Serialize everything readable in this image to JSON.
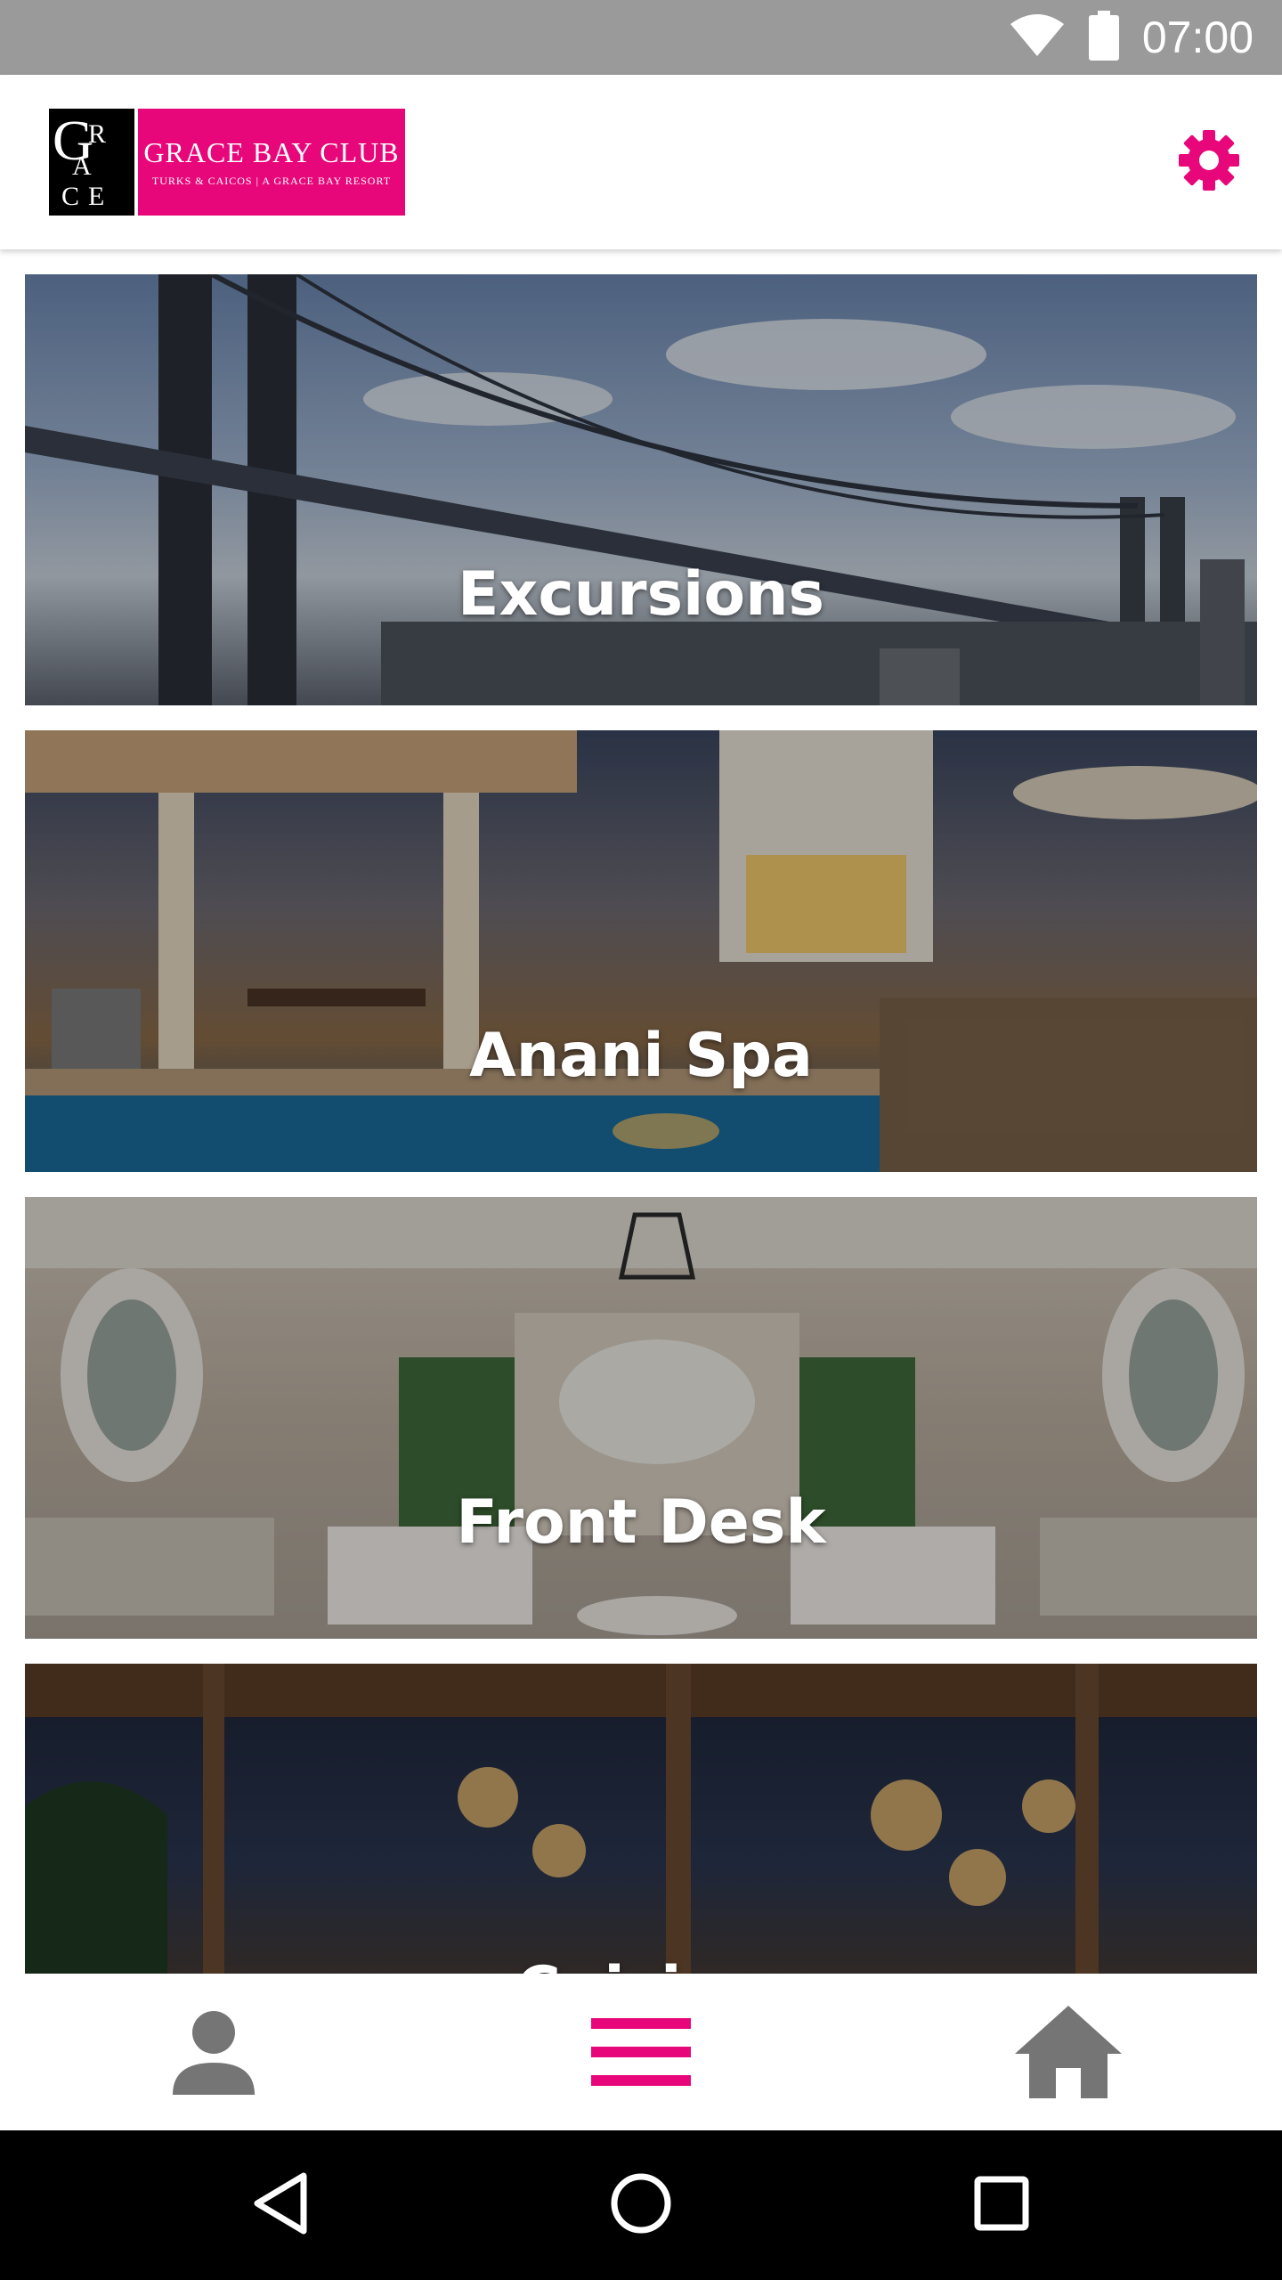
{
  "status_bar": {
    "time": "07:00",
    "icons": [
      "wifi-icon",
      "battery-icon"
    ]
  },
  "header": {
    "logo": {
      "mark": "GRACE",
      "name": "GRACE BAY CLUB",
      "subtitle": "TURKS & CAICOS | A GRACE BAY RESORT"
    },
    "settings_icon": "gear-icon"
  },
  "colors": {
    "accent": "#e8077a",
    "icon_gray": "#757575"
  },
  "menu": {
    "items": [
      {
        "label": "Excursions"
      },
      {
        "label": "Anani Spa"
      },
      {
        "label": "Front Desk"
      },
      {
        "label": "Cuisine"
      }
    ]
  },
  "bottom_nav": {
    "items": [
      {
        "icon": "person-icon",
        "active": false
      },
      {
        "icon": "menu-icon",
        "active": true
      },
      {
        "icon": "home-icon",
        "active": false
      }
    ]
  },
  "system_nav": [
    "back-icon",
    "home-circle-icon",
    "recents-icon"
  ]
}
